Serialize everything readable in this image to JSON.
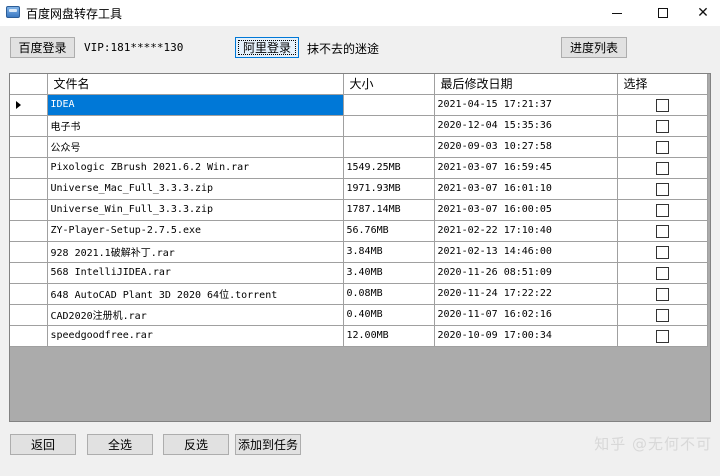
{
  "window": {
    "title": "百度网盘转存工具",
    "minimize_icon": "minimize-icon",
    "maximize_icon": "maximize-icon",
    "close_icon": "close-icon",
    "close_label": "✕"
  },
  "toolbar": {
    "baidu_login": "百度登录",
    "vip_text": "VIP:181*****130",
    "ali_login": "阿里登录",
    "ali_user": "抹不去的迷途",
    "progress_list": "进度列表"
  },
  "grid": {
    "columns": [
      "文件名",
      "大小",
      "最后修改日期",
      "选择"
    ],
    "rows": [
      {
        "name": "IDEA",
        "size": "",
        "date": "2021-04-15 17:21:37",
        "selected_row": true
      },
      {
        "name": "电子书",
        "size": "",
        "date": "2020-12-04 15:35:36"
      },
      {
        "name": "公众号",
        "size": "",
        "date": "2020-09-03 10:27:58"
      },
      {
        "name": "Pixologic ZBrush 2021.6.2 Win.rar",
        "size": "1549.25MB",
        "date": "2021-03-07 16:59:45"
      },
      {
        "name": "Universe_Mac_Full_3.3.3.zip",
        "size": "1971.93MB",
        "date": "2021-03-07 16:01:10"
      },
      {
        "name": "Universe_Win_Full_3.3.3.zip",
        "size": "1787.14MB",
        "date": "2021-03-07 16:00:05"
      },
      {
        "name": "ZY-Player-Setup-2.7.5.exe",
        "size": "56.76MB",
        "date": "2021-02-22 17:10:40"
      },
      {
        "name": "928 2021.1破解补丁.rar",
        "size": "3.84MB",
        "date": "2021-02-13 14:46:00"
      },
      {
        "name": "568 IntelliJIDEA.rar",
        "size": "3.40MB",
        "date": "2020-11-26 08:51:09"
      },
      {
        "name": "648 AutoCAD Plant 3D 2020 64位.torrent",
        "size": "0.08MB",
        "date": "2020-11-24 17:22:22"
      },
      {
        "name": "CAD2020注册机.rar",
        "size": "0.40MB",
        "date": "2020-11-07 16:02:16"
      },
      {
        "name": "speedgoodfree.rar",
        "size": "12.00MB",
        "date": "2020-10-09 17:00:34"
      }
    ]
  },
  "footer": {
    "back": "返回",
    "select_all": "全选",
    "invert": "反选",
    "add_task": "添加到任务",
    "watermark": "知乎 @无何不可"
  }
}
